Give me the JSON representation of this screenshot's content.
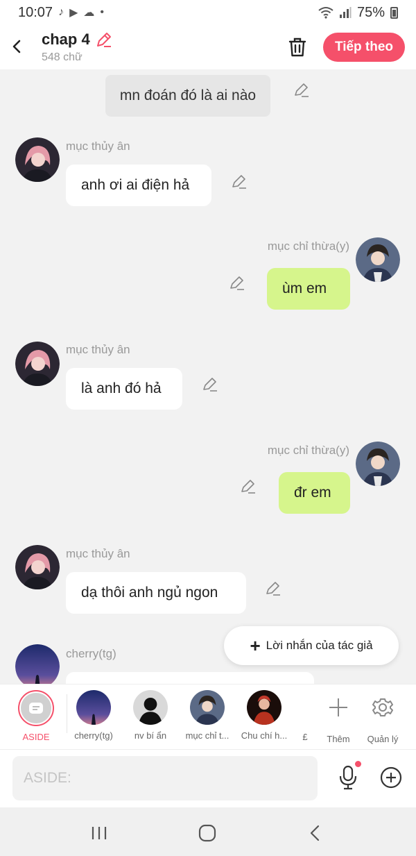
{
  "status": {
    "time": "10:07",
    "battery": "75%",
    "left_icons": [
      "tiktok-icon",
      "youtube-icon",
      "cloud-icon",
      "dot-icon"
    ],
    "right_icons": [
      "wifi-icon",
      "signal-icon",
      "battery-icon"
    ]
  },
  "header": {
    "title": "chap 4",
    "subtitle": "548 chữ",
    "next_label": "Tiếp theo"
  },
  "messages": [
    {
      "type": "aside",
      "text": "mn đoán đó là ai nào"
    },
    {
      "side": "left",
      "name": "mục thủy ân",
      "text": "anh ơi ai điện hả"
    },
    {
      "side": "right",
      "name": "mục chỉ thừa(y)",
      "text": "ùm em"
    },
    {
      "side": "left",
      "name": "mục thủy ân",
      "text": "là anh đó hả"
    },
    {
      "side": "right",
      "name": "mục chỉ thừa(y)",
      "text": "đr em"
    },
    {
      "side": "left",
      "name": "mục thủy ân",
      "text": "dạ thôi anh ngủ ngon"
    },
    {
      "side": "left",
      "name": "cherry(tg)",
      "text": ""
    }
  ],
  "author_note": {
    "label": "Lời nhắn của tác giả"
  },
  "characters": [
    {
      "label": "ASIDE"
    },
    {
      "label": "cherry(tg)"
    },
    {
      "label": "nv bí ẩn"
    },
    {
      "label": "mục chỉ t..."
    },
    {
      "label": "Chu chí h..."
    },
    {
      "label": "£"
    }
  ],
  "actions": {
    "add_label": "Thêm",
    "manage_label": "Quản lý"
  },
  "input": {
    "placeholder": "ASIDE:",
    "value": ""
  },
  "colors": {
    "accent": "#f5506a",
    "green_bubble": "#d6f58c",
    "background": "#f2f2f2"
  }
}
